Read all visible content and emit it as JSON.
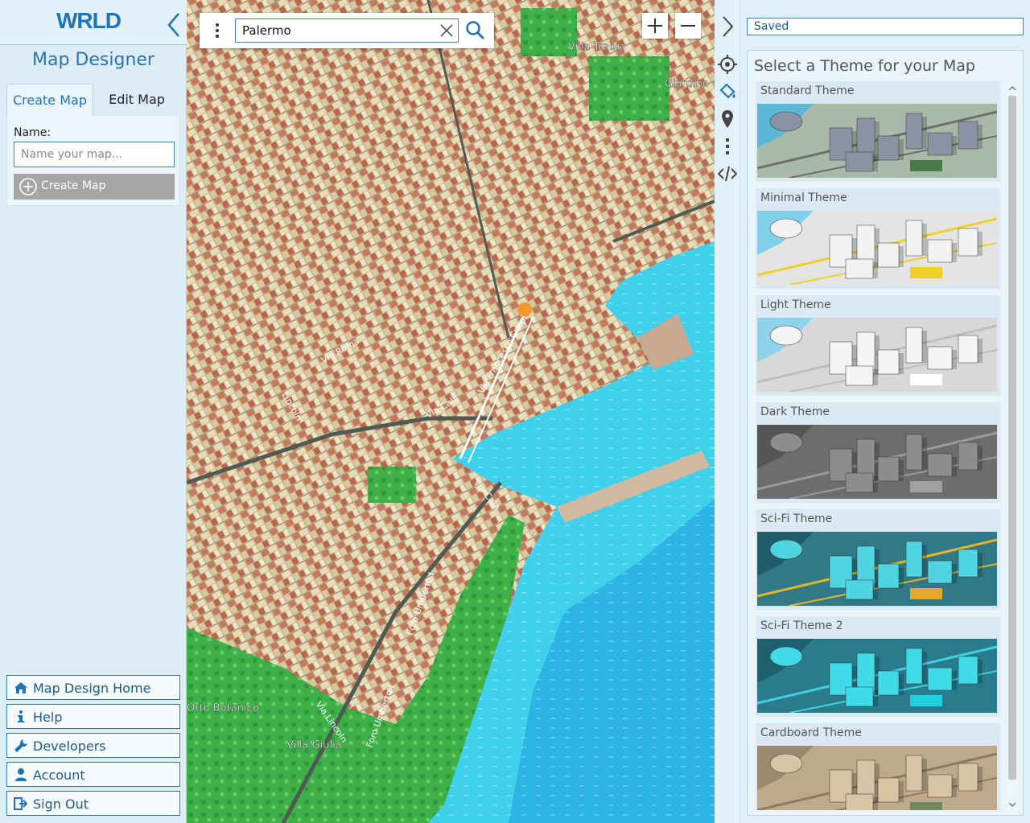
{
  "brand": {
    "logo": "WRLD"
  },
  "sidebar": {
    "title": "Map Designer",
    "tabs": [
      {
        "label": "Create Map"
      },
      {
        "label": "Edit Map"
      }
    ],
    "create": {
      "name_label": "Name:",
      "name_placeholder": "Name your map...",
      "name_value": "",
      "button_label": "Create Map"
    },
    "nav": [
      {
        "label": "Map Design Home",
        "icon": "home-icon"
      },
      {
        "label": "Help",
        "icon": "info-icon"
      },
      {
        "label": "Developers",
        "icon": "wrench-icon"
      },
      {
        "label": "Account",
        "icon": "user-icon"
      },
      {
        "label": "Sign Out",
        "icon": "sign-out-icon"
      }
    ]
  },
  "map": {
    "search_value": "Palermo",
    "labels": [
      "Villa Trabia",
      "Giardino",
      "Via Cala",
      "Via Cala",
      "Foro Umberto I",
      "Foro Umberto I",
      "Via Lincoln",
      "Orto Botanico",
      "Villa Giulia",
      "Via Roma",
      "Lincoln",
      "Via Francesco Crispi"
    ]
  },
  "right": {
    "saved_label": "Saved",
    "heading": "Select a Theme for your Map",
    "themes": [
      {
        "name": "Standard Theme",
        "palette": {
          "ground": "#a9b9a7",
          "water": "#5ab8d6",
          "building": "#8a93a3",
          "accent": "#4a7a4a",
          "line": "#6f6f6f"
        }
      },
      {
        "name": "Minimal Theme",
        "palette": {
          "ground": "#e4e4e4",
          "water": "#7fd0ea",
          "building": "#f2f2f2",
          "accent": "#f0cf2c",
          "line": "#f0cf2c"
        }
      },
      {
        "name": "Light Theme",
        "palette": {
          "ground": "#d8d8d8",
          "water": "#8ed3ea",
          "building": "#f4f4f4",
          "accent": "#ffffff",
          "line": "#bdbdbd"
        }
      },
      {
        "name": "Dark Theme",
        "palette": {
          "ground": "#6d6d6d",
          "water": "#555555",
          "building": "#8d8d8d",
          "accent": "#a0a0a0",
          "line": "#9a9a9a"
        }
      },
      {
        "name": "Sci-Fi Theme",
        "palette": {
          "ground": "#2f7a86",
          "water": "#1f5d6a",
          "building": "#4fd5e2",
          "accent": "#e6a72a",
          "line": "#e6b52a"
        }
      },
      {
        "name": "Sci-Fi Theme 2",
        "palette": {
          "ground": "#2a7c8c",
          "water": "#1e6070",
          "building": "#3fdbe9",
          "accent": "#1fcfe0",
          "line": "#42d0e0"
        }
      },
      {
        "name": "Cardboard Theme",
        "palette": {
          "ground": "#bfa98b",
          "water": "#9c8a70",
          "building": "#d8c4a4",
          "accent": "#6f8a5a",
          "line": "#8d7a60"
        }
      }
    ]
  },
  "colors": {
    "accent": "#1f73b7",
    "water": "#3fd0ec",
    "park": "#3db04a",
    "roof": "#c47a5a",
    "ground": "#cbb995"
  }
}
